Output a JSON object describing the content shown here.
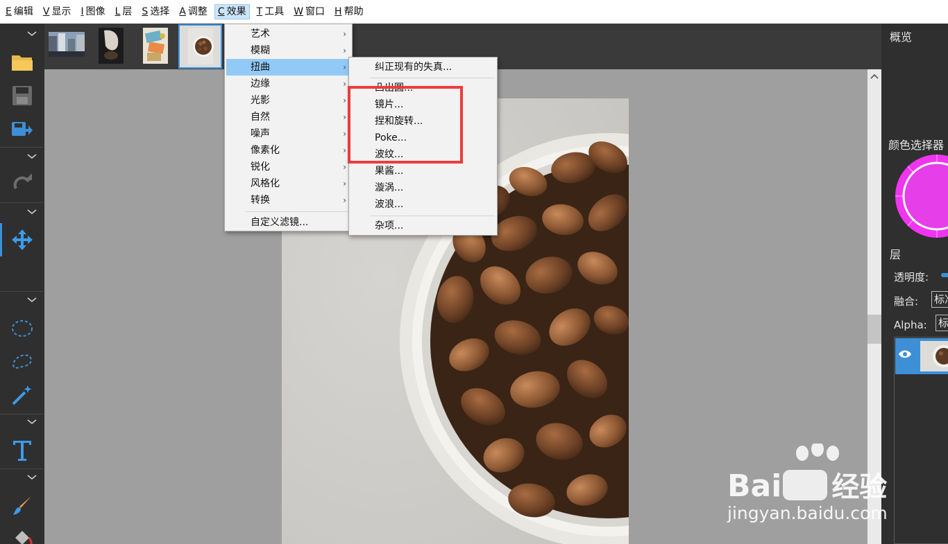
{
  "menubar": [
    {
      "key": "E",
      "label": "编辑"
    },
    {
      "key": "V",
      "label": "显示"
    },
    {
      "key": "I",
      "label": "图像"
    },
    {
      "key": "L",
      "label": "层"
    },
    {
      "key": "S",
      "label": "选择"
    },
    {
      "key": "A",
      "label": "调整"
    },
    {
      "key": "C",
      "label": "效果",
      "active": true
    },
    {
      "key": "T",
      "label": "工具"
    },
    {
      "key": "W",
      "label": "窗口"
    },
    {
      "key": "H",
      "label": "帮助"
    }
  ],
  "effects_menu": {
    "items": [
      "艺术",
      "模糊",
      "扭曲",
      "边缘",
      "光影",
      "自然",
      "噪声",
      "像素化",
      "锐化",
      "风格化",
      "转换"
    ],
    "highlighted": "扭曲",
    "custom_filter": "自定义滤镜...",
    "submenu_glyph": "›"
  },
  "distort_submenu": {
    "top_item": "纠正现有的失真...",
    "items": [
      "凸出圆...",
      "镜片...",
      "捏和旋转...",
      "Poke...",
      "波纹...",
      "果酱...",
      "漩涡...",
      "波浪..."
    ],
    "bottom_item": "杂项..."
  },
  "right_panel": {
    "overview_title": "概览",
    "color_picker_title": "颜色选择器",
    "layers_title": "层",
    "opacity_label": "透明度:",
    "blend_label": "融合:",
    "blend_value": "标准",
    "alpha_label": "Alpha:",
    "alpha_value": "标准"
  },
  "watermark": {
    "brand": "Bai",
    "brand2": "经验",
    "url": "jingyan.baidu.com"
  },
  "colors": {
    "accent": "#3d8fd6",
    "menu_highlight": "#91c9f7",
    "annotation_red": "#ef3b3b",
    "color_wheel": "#f035f0"
  }
}
